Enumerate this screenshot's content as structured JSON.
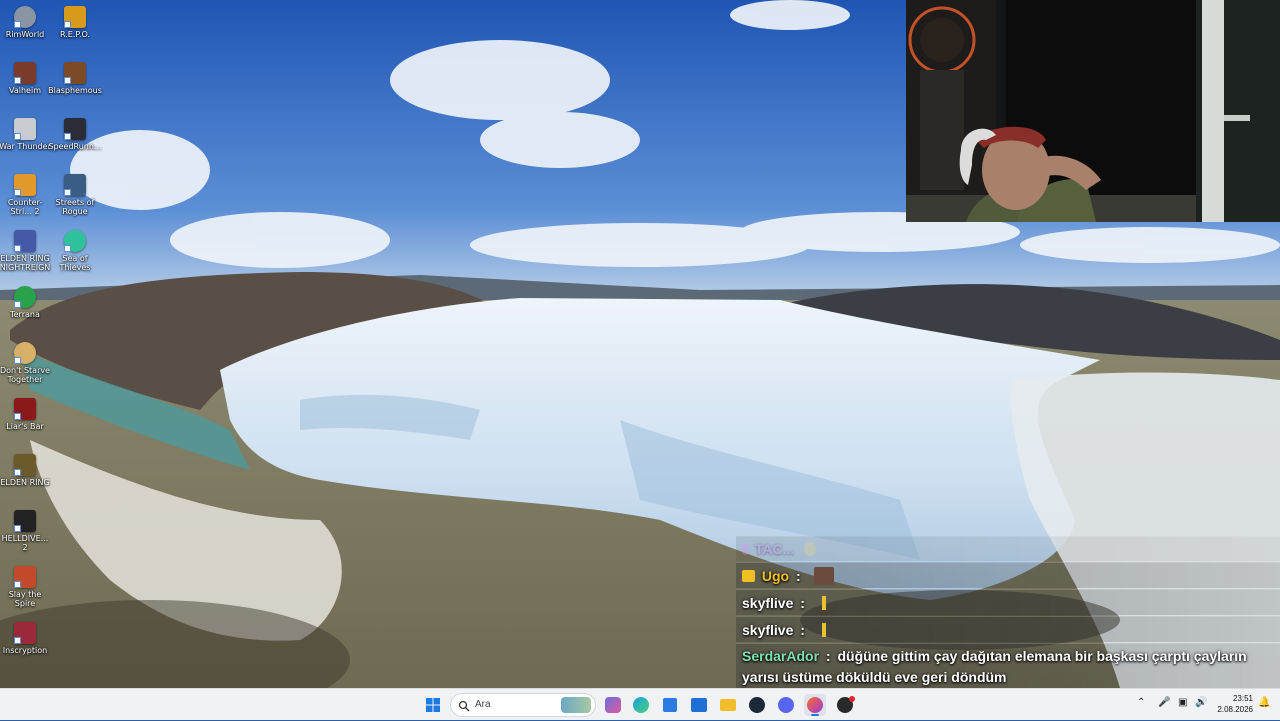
{
  "desktop": {
    "icons": [
      {
        "label": "RimWorld",
        "icon": "rimworld-icon",
        "color": "#8a95a3"
      },
      {
        "label": "R.E.P.O.",
        "icon": "repo-icon",
        "color": "#d89a1a"
      },
      {
        "label": "Valheim",
        "icon": "valheim-icon",
        "color": "#7a3b2b"
      },
      {
        "label": "Blasphemous",
        "icon": "blasphemous-icon",
        "color": "#7b4a26"
      },
      {
        "label": "War Thunder",
        "icon": "war-thunder-icon",
        "color": "#c8cbd0"
      },
      {
        "label": "SpeedRunn...",
        "icon": "speedrunners-icon",
        "color": "#2a2d36"
      },
      {
        "label": "Counter-Stri... 2",
        "icon": "counter-strike-icon",
        "color": "#e39a2b"
      },
      {
        "label": "Streets of Rogue",
        "icon": "streets-of-rogue-icon",
        "color": "#3a5d86"
      },
      {
        "label": "ELDEN RING NIGHTREIGN",
        "icon": "nightreign-icon",
        "color": "#4658a8"
      },
      {
        "label": "Sea of Thieves",
        "icon": "sea-of-thieves-icon",
        "color": "#2fc29a"
      },
      {
        "label": "Terrana",
        "icon": "terrana-icon",
        "color": "#2aa24a"
      },
      {
        "label": "Don't Starve Together",
        "icon": "dont-starve-icon",
        "color": "#d9b068"
      },
      {
        "label": "Liar's Bar",
        "icon": "liars-bar-icon",
        "color": "#8a1a1a"
      },
      {
        "label": "ELDEN RING",
        "icon": "elden-ring-icon",
        "color": "#6c5a2a"
      },
      {
        "label": "HELLDIVE... 2",
        "icon": "helldivers-icon",
        "color": "#222222"
      },
      {
        "label": "Slay the Spire",
        "icon": "slay-the-spire-icon",
        "color": "#c24a2a"
      },
      {
        "label": "Inscryption",
        "icon": "inscryption-icon",
        "color": "#9a2a3a"
      }
    ]
  },
  "chat": {
    "messages": [
      {
        "user": "TAC...",
        "color": "#c06cd8",
        "text": "",
        "faded": true
      },
      {
        "user": "Ugo",
        "color": "#f0c020",
        "text": "",
        "badge": "crown-badge-icon"
      },
      {
        "user": "skyflive",
        "color": "#ffffff",
        "text": ""
      },
      {
        "user": "skyflive",
        "color": "#ffffff",
        "text": ""
      },
      {
        "user": "SerdarAdor",
        "color": "#7ee0b0",
        "text": "düğüne gittim çay dağıtan elemana bir başkası çarptı çayların yarısı üstüme döküldü eve geri döndüm"
      }
    ]
  },
  "taskbar": {
    "search_placeholder": "Ara",
    "time": "23:51",
    "date": "2.08.2026",
    "apps": [
      {
        "icon": "windows-start-icon",
        "color": "#1f7ae0"
      },
      {
        "icon": "widgets-icon",
        "color": "#6a6fdc"
      },
      {
        "icon": "edge-icon",
        "color": "#1aa0e0"
      },
      {
        "icon": "store-icon",
        "color": "#2b7be3"
      },
      {
        "icon": "outlook-icon",
        "color": "#1e6fd6"
      },
      {
        "icon": "file-explorer-icon",
        "color": "#f2bd2c"
      },
      {
        "icon": "steam-icon",
        "color": "#1b2838"
      },
      {
        "icon": "discord-icon",
        "color": "#5865f2"
      },
      {
        "icon": "firefox-icon",
        "color": "#ff6b2c"
      },
      {
        "icon": "obs-icon",
        "color": "#2a2a2a"
      }
    ]
  }
}
